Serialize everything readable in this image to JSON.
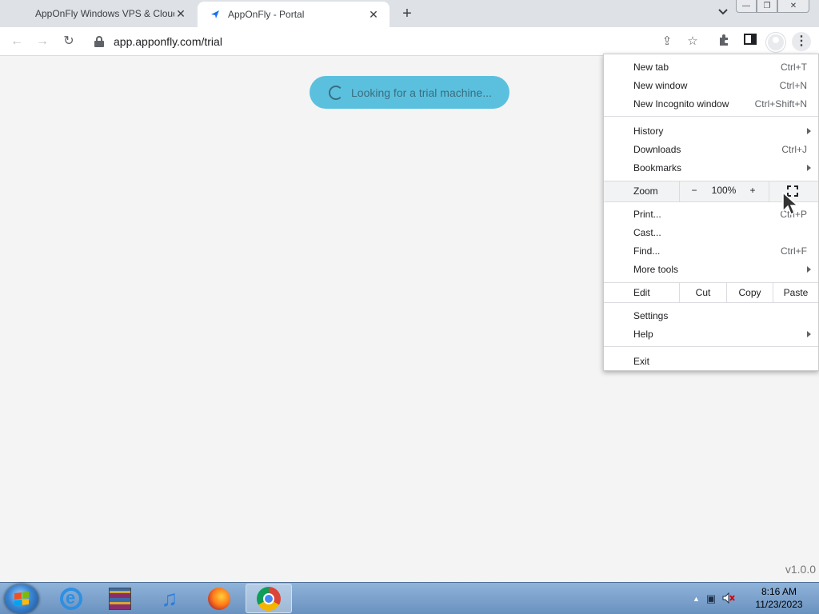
{
  "tabs": [
    {
      "title": "AppOnFly Windows VPS & Cloud",
      "active": false
    },
    {
      "title": "AppOnFly - Portal",
      "active": true
    }
  ],
  "icons": {
    "close": "✕",
    "new_tab": "+",
    "tab_search": "⌄",
    "back": "←",
    "forward": "→",
    "reload": "↻",
    "share": "⇪",
    "star": "☆",
    "extensions": "✦",
    "sidepanel": "▮",
    "menu": "⋮",
    "speaker": "🔇",
    "network": "▣",
    "tray_up": "▲"
  },
  "address_bar": {
    "url": "app.apponfly.com/trial"
  },
  "page": {
    "loading_text": "Looking for a trial machine...",
    "version": "v1.0.0",
    "accent_color": "#5bc0de"
  },
  "menu": {
    "new_tab": {
      "label": "New tab",
      "shortcut": "Ctrl+T"
    },
    "new_window": {
      "label": "New window",
      "shortcut": "Ctrl+N"
    },
    "incognito": {
      "label": "New Incognito window",
      "shortcut": "Ctrl+Shift+N"
    },
    "history": {
      "label": "History"
    },
    "downloads": {
      "label": "Downloads",
      "shortcut": "Ctrl+J"
    },
    "bookmarks": {
      "label": "Bookmarks"
    },
    "zoom": {
      "label": "Zoom",
      "minus": "−",
      "value": "100%",
      "plus": "+"
    },
    "print": {
      "label": "Print...",
      "shortcut": "Ctrl+P"
    },
    "cast": {
      "label": "Cast..."
    },
    "find": {
      "label": "Find...",
      "shortcut": "Ctrl+F"
    },
    "more_tools": {
      "label": "More tools"
    },
    "edit": {
      "label": "Edit",
      "cut": "Cut",
      "copy": "Copy",
      "paste": "Paste"
    },
    "settings": {
      "label": "Settings"
    },
    "help": {
      "label": "Help"
    },
    "exit": {
      "label": "Exit"
    }
  },
  "taskbar": {
    "apps": [
      "internet-explorer",
      "winrar",
      "itunes",
      "firefox",
      "chrome"
    ],
    "music_glyph": "♫",
    "clock_time": "8:16 AM",
    "clock_date": "11/23/2023"
  }
}
